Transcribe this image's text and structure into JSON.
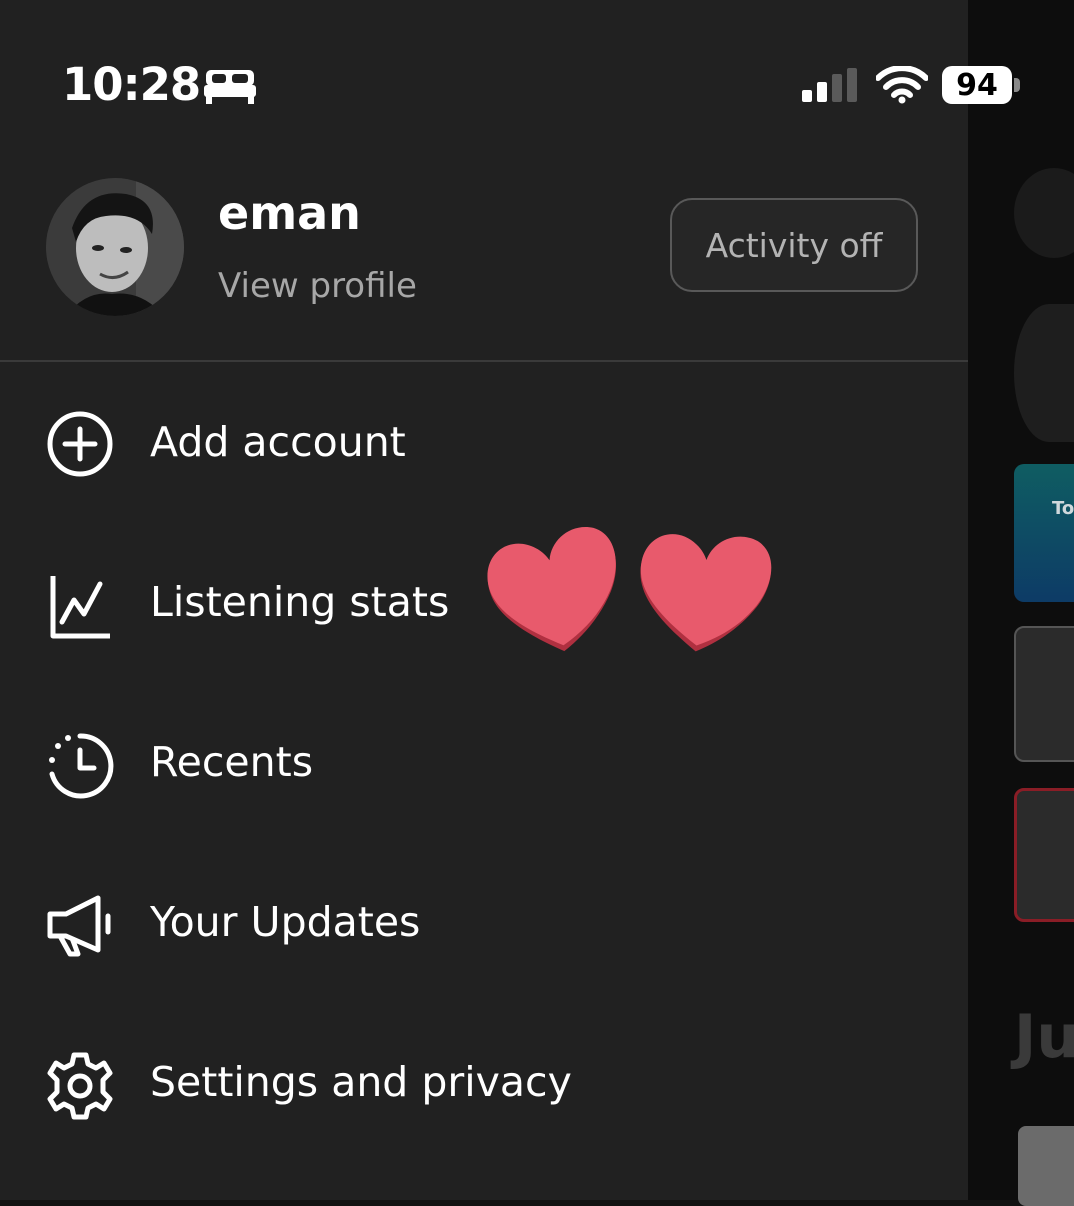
{
  "status_bar": {
    "time": "10:28",
    "battery_level": "94",
    "icons": [
      "bed-icon",
      "signal-icon",
      "wifi-icon",
      "battery-icon"
    ]
  },
  "profile": {
    "name": "eman",
    "view_profile_label": "View profile",
    "activity_button_label": "Activity off"
  },
  "menu": {
    "items": [
      {
        "label": "Add account",
        "icon": "add-circle-icon"
      },
      {
        "label": "Listening stats",
        "icon": "stats-chart-icon"
      },
      {
        "label": "Recents",
        "icon": "recents-clock-icon"
      },
      {
        "label": "Your Updates",
        "icon": "megaphone-icon"
      },
      {
        "label": "Settings and privacy",
        "icon": "gear-icon"
      }
    ]
  },
  "decorations": {
    "hearts": [
      "heart-sticker-icon",
      "heart-sticker-icon"
    ],
    "heart_color": "#e85a6c"
  },
  "background_peek": {
    "card_text": "To",
    "heading_fragment": "Ju"
  },
  "colors": {
    "drawer_bg": "#212121",
    "text_primary": "#ffffff",
    "text_secondary": "#a7a7a7"
  }
}
